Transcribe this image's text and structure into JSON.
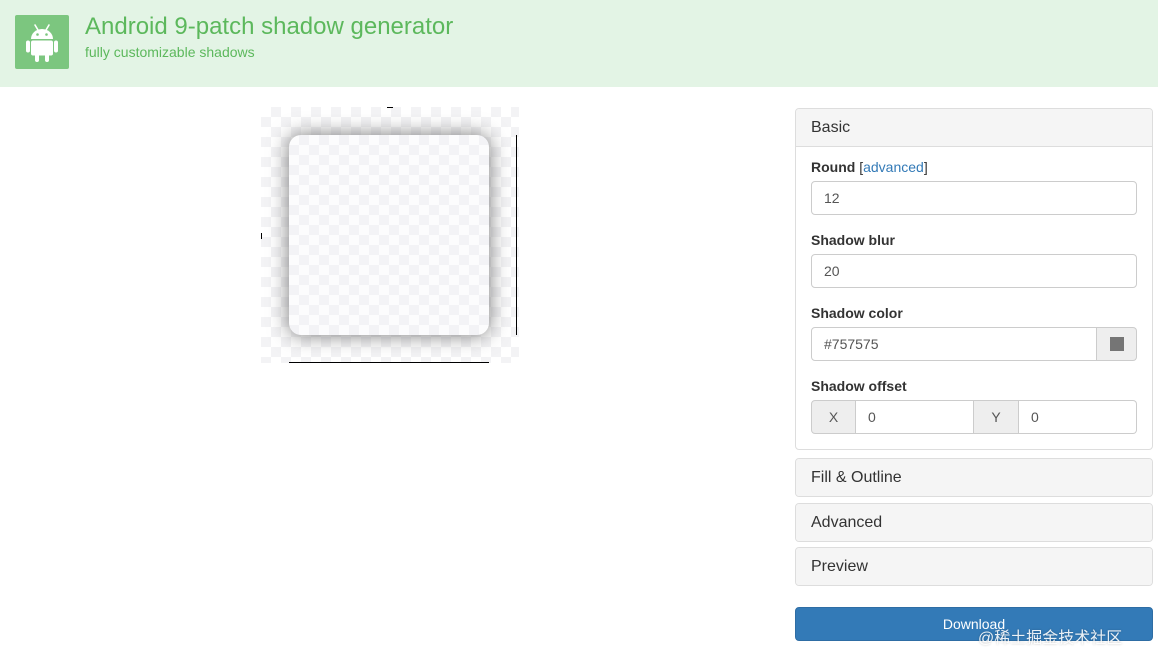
{
  "header": {
    "title": "Android 9-patch shadow generator",
    "subtitle": "fully customizable shadows",
    "logo_icon": "android-robot-icon",
    "background": "#e3f4e5",
    "accent": "#5cb85c"
  },
  "preview": {
    "round": 12,
    "shadow_blur": 20,
    "shadow_color": "#757575"
  },
  "basic": {
    "heading": "Basic",
    "round_label": "Round",
    "round_link_open": "[",
    "round_link": "advanced",
    "round_link_close": "]",
    "round_value": "12",
    "blur_label": "Shadow blur",
    "blur_value": "20",
    "color_label": "Shadow color",
    "color_value": "#757575",
    "offset_label": "Shadow offset",
    "offset_x_label": "X",
    "offset_x_value": "0",
    "offset_y_label": "Y",
    "offset_y_value": "0"
  },
  "panels": {
    "fill_outline": "Fill & Outline",
    "advanced": "Advanced",
    "preview": "Preview"
  },
  "download_label": "Download",
  "watermark": "@稀土掘金技术社区"
}
